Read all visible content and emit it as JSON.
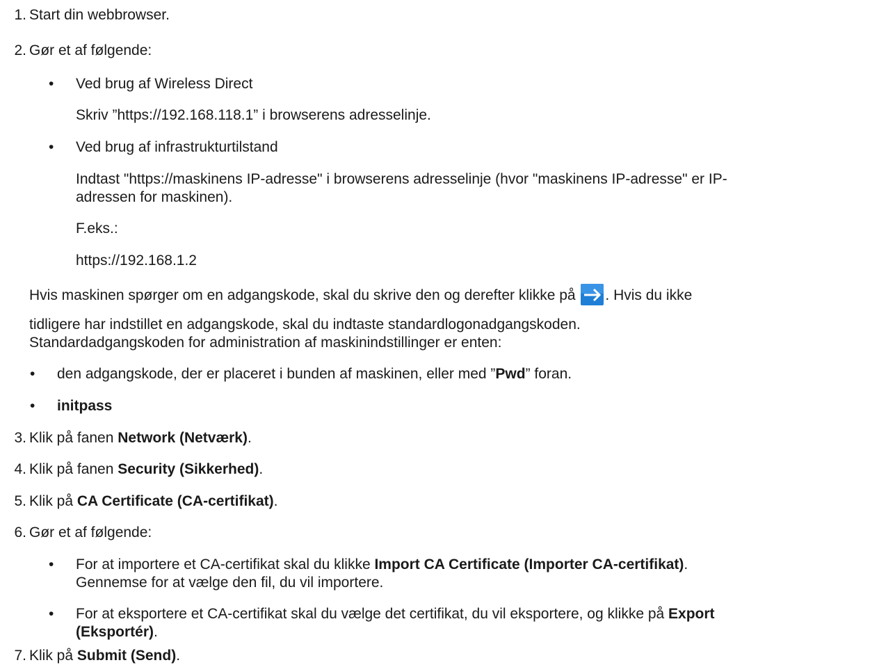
{
  "steps": {
    "s1": {
      "num": "1.",
      "text": "Start din webbrowser."
    },
    "s2": {
      "num": "2.",
      "text": "Gør et af følgende:",
      "b1": {
        "bullet": "•",
        "title": "Ved brug af Wireless Direct",
        "detail": "Skriv ”https://192.168.118.1” i browserens adresselinje."
      },
      "b2": {
        "bullet": "•",
        "title": "Ved brug af infrastrukturtilstand",
        "detail_line1": "Indtast \"https://maskinens IP-adresse\" i browserens adresselinje (hvor \"maskinens IP-adresse\" er IP-",
        "detail_line2": "adressen for maskinen).",
        "example_label": "F.eks.:",
        "example_url": "https://192.168.1.2"
      },
      "password_note": {
        "line1_before": "Hvis maskinen spørger om en adgangskode, skal du skrive den og derefter klikke på ",
        "line1_after": ". Hvis du ikke",
        "line2": "tidligere har indstillet en adgangskode, skal du indtaste standardlogonadgangskoden.",
        "line3": "Standardadgangskoden for administration af maskinindstillinger er enten:"
      },
      "pw1": {
        "bullet": "•",
        "before": "den adgangskode, der er placeret i bunden af maskinen, eller med ”",
        "bold": "Pwd",
        "after": "” foran."
      },
      "pw2": {
        "bullet": "•",
        "bold": "initpass"
      }
    },
    "s3": {
      "num": "3.",
      "before": "Klik på fanen ",
      "bold": "Network (Netværk)",
      "after": "."
    },
    "s4": {
      "num": "4.",
      "before": "Klik på fanen ",
      "bold": "Security (Sikkerhed)",
      "after": "."
    },
    "s5": {
      "num": "5.",
      "before": "Klik på ",
      "bold": "CA Certificate (CA-certifikat)",
      "after": "."
    },
    "s6": {
      "num": "6.",
      "text": "Gør et af følgende:",
      "b1": {
        "bullet": "•",
        "before": "For at importere et CA-certifikat skal du klikke ",
        "bold": "Import CA Certificate (Importer CA-certifikat)",
        "after": ".",
        "line2": "Gennemse for at vælge den fil, du vil importere."
      },
      "b2": {
        "bullet": "•",
        "before": "For at eksportere et CA-certifikat skal du vælge det certifikat, du vil eksportere, og klikke på ",
        "bold1": "Export",
        "bold2": "(Eksportér)",
        "after": "."
      }
    },
    "s7": {
      "num": "7.",
      "before": "Klik på ",
      "bold": "Submit (Send)",
      "after": "."
    }
  },
  "colors": {
    "arrow_bg": "#1f7fd6",
    "arrow_fg": "#ffffff",
    "text": "#1a1a1a"
  },
  "icons": {
    "arrow": "right-arrow-icon"
  }
}
